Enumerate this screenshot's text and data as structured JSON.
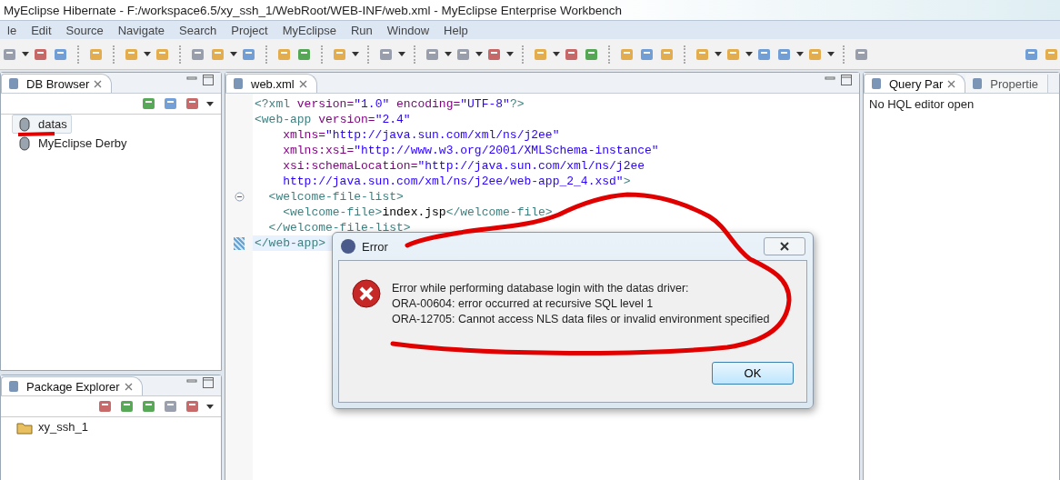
{
  "window": {
    "title": "MyEclipse Hibernate - F:/workspace6.5/xy_ssh_1/WebRoot/WEB-INF/web.xml - MyEclipse Enterprise Workbench"
  },
  "menu": [
    "le",
    "Edit",
    "Source",
    "Navigate",
    "Search",
    "Project",
    "MyEclipse",
    "Run",
    "Window",
    "Help"
  ],
  "db_browser": {
    "tabs": [
      {
        "label": "DB Browser",
        "selected": true
      }
    ],
    "items": [
      {
        "label": "datas",
        "selected": true
      },
      {
        "label": "MyEclipse Derby",
        "selected": false
      }
    ]
  },
  "package_explorer": {
    "tabs": [
      {
        "label": "Package Explorer",
        "selected": true
      }
    ],
    "items": [
      {
        "label": "xy_ssh_1",
        "selected": false
      }
    ]
  },
  "editor": {
    "tabs": [
      {
        "label": "web.xml",
        "selected": true
      }
    ],
    "lines": [
      {
        "tokens": [
          {
            "kind": "tag",
            "text": "<?xml"
          },
          {
            "kind": "attr",
            "text": " version="
          },
          {
            "kind": "value",
            "text": "\"1.0\""
          },
          {
            "kind": "attr",
            "text": " encoding="
          },
          {
            "kind": "value",
            "text": "\"UTF-8\""
          },
          {
            "kind": "tag",
            "text": "?>"
          }
        ]
      },
      {
        "tokens": [
          {
            "kind": "tag",
            "text": "<web-app"
          },
          {
            "kind": "attr",
            "text": " version="
          },
          {
            "kind": "value",
            "text": "\"2.4\""
          }
        ]
      },
      {
        "tokens": [
          {
            "kind": "attr",
            "text": "    xmlns="
          },
          {
            "kind": "value",
            "text": "\"http://java.sun.com/xml/ns/j2ee\""
          }
        ]
      },
      {
        "tokens": [
          {
            "kind": "attr",
            "text": "    xmlns:xsi="
          },
          {
            "kind": "value",
            "text": "\"http://www.w3.org/2001/XMLSchema-instance\""
          }
        ]
      },
      {
        "tokens": [
          {
            "kind": "attr",
            "text": "    xsi:schemaLocation="
          },
          {
            "kind": "value",
            "text": "\"http://java.sun.com/xml/ns/j2ee"
          }
        ]
      },
      {
        "tokens": [
          {
            "kind": "value",
            "text": "    http://java.sun.com/xml/ns/j2ee/web-app_2_4.xsd\""
          },
          {
            "kind": "tag",
            "text": ">"
          }
        ]
      },
      {
        "folded": false,
        "tokens": [
          {
            "kind": "tag",
            "text": "  <welcome-file-list>"
          }
        ]
      },
      {
        "tokens": [
          {
            "kind": "tag",
            "text": "    <welcome-file>"
          },
          {
            "kind": "text",
            "text": "index.jsp"
          },
          {
            "kind": "tag",
            "text": "</welcome-file>"
          }
        ]
      },
      {
        "tokens": [
          {
            "kind": "tag",
            "text": "  </welcome-file-list>"
          }
        ]
      },
      {
        "current": true,
        "tokens": [
          {
            "kind": "tag",
            "text": "</web-app>"
          }
        ]
      }
    ]
  },
  "side_panel": {
    "tabs": [
      {
        "label": "Query Par",
        "selected": true
      },
      {
        "label": "Propertie",
        "selected": false
      }
    ],
    "message": "No HQL editor open"
  },
  "dialog": {
    "title": "Error",
    "message_lines": [
      "Error while performing database login with the datas driver:",
      "ORA-00604: error occurred at recursive SQL level 1",
      "ORA-12705: Cannot access NLS data files or invalid environment specified"
    ],
    "button": "OK"
  }
}
